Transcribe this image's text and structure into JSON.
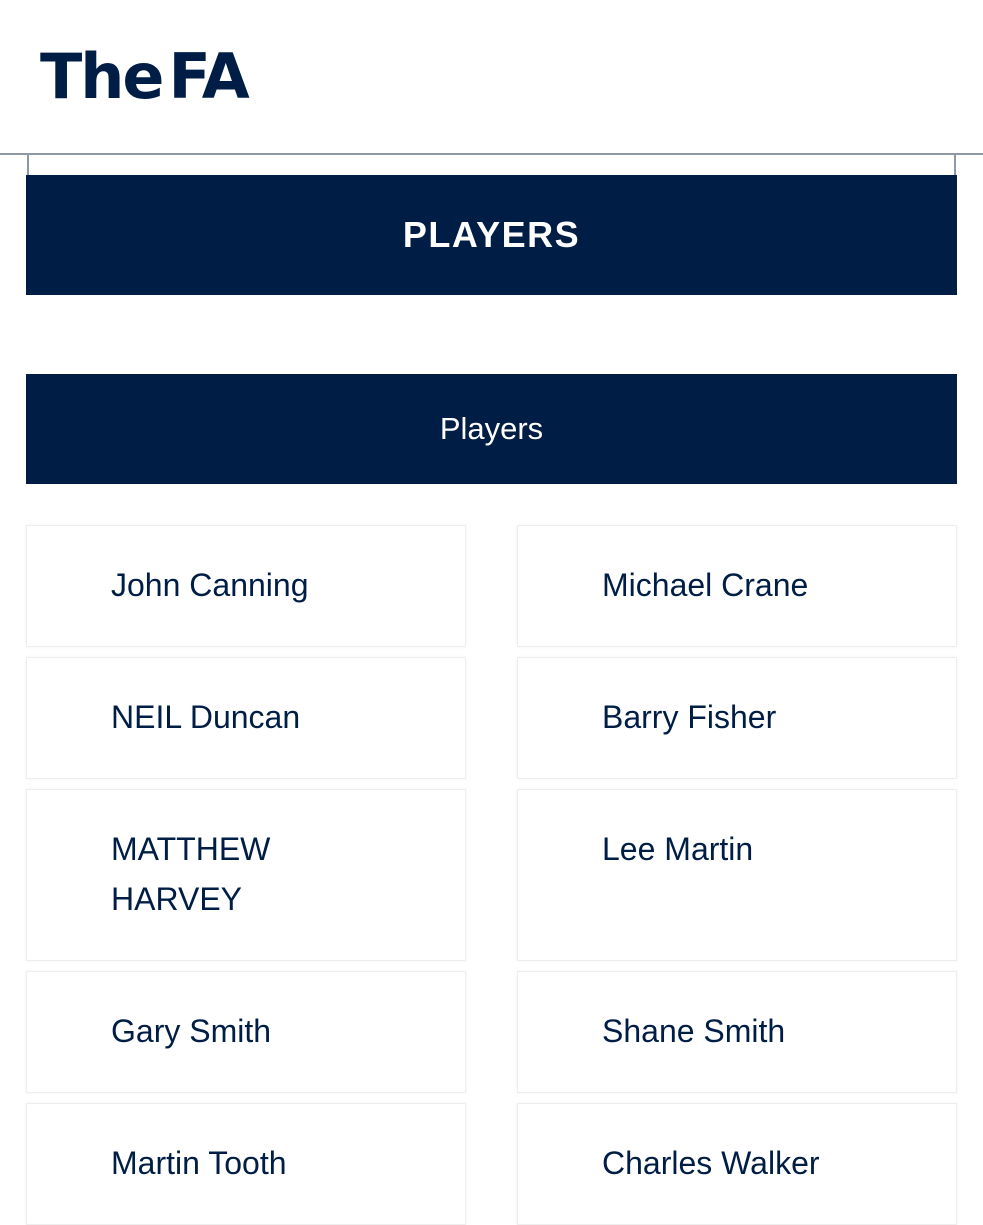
{
  "header": {
    "logo_the": "The",
    "logo_fa": "FA"
  },
  "banner": {
    "title": "PLAYERS"
  },
  "section": {
    "title": "Players"
  },
  "players": [
    "John Canning",
    "Michael Crane",
    "NEIL Duncan",
    "Barry Fisher",
    "MATTHEW HARVEY",
    "Lee Martin",
    "Gary Smith",
    "Shane Smith",
    "Martin Tooth",
    "Charles Walker"
  ],
  "colors": {
    "brand_navy": "#001e45",
    "divider": "#8e98a6"
  }
}
